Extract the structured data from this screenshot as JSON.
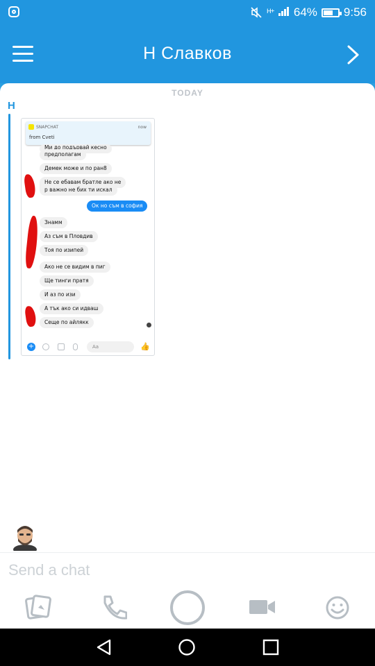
{
  "status": {
    "battery_percent": "64%",
    "battery_level": 0.64,
    "time": "9:56",
    "signal_text": "ᴴ⁺"
  },
  "header": {
    "title": "Н Славков"
  },
  "chat": {
    "date_divider": "TODAY",
    "sender_initial": "H",
    "screenshot": {
      "notification": {
        "app": "SNAPCHAT",
        "time": "now",
        "text": "from Cveti"
      },
      "messages": [
        {
          "text": "Ми до подървай кесно",
          "dir": "in"
        },
        {
          "text": "предполагам",
          "dir": "in"
        },
        {
          "text": "Демек може и по ран8",
          "dir": "in"
        },
        {
          "text": "Не се ебавам братле ако не",
          "dir": "in"
        },
        {
          "text": "р важно не бих ти искал",
          "dir": "in"
        },
        {
          "text": "Ок но съм в софия",
          "dir": "out"
        },
        {
          "text": "Знамм",
          "dir": "in"
        },
        {
          "text": "Аз съм в Пловдив",
          "dir": "in"
        },
        {
          "text": "Тоя по изипей",
          "dir": "in"
        },
        {
          "text": "Ако не се видим в пиг",
          "dir": "in"
        },
        {
          "text": "Ще тинги пратя",
          "dir": "in"
        },
        {
          "text": "И аз по изи",
          "dir": "in"
        },
        {
          "text": "А тък ако си идваш",
          "dir": "in"
        },
        {
          "text": "Сеще по айлякк",
          "dir": "in"
        }
      ],
      "composer_placeholder": "Аа"
    }
  },
  "input": {
    "placeholder": "Send a chat"
  },
  "actions": [
    {
      "name": "memories-icon"
    },
    {
      "name": "phone-icon"
    },
    {
      "name": "camera-capture-icon"
    },
    {
      "name": "video-call-icon"
    },
    {
      "name": "emoji-icon"
    }
  ],
  "colors": {
    "brand_blue": "#2196df",
    "messenger_blue": "#1a8cf5",
    "redaction_red": "#e01010"
  }
}
